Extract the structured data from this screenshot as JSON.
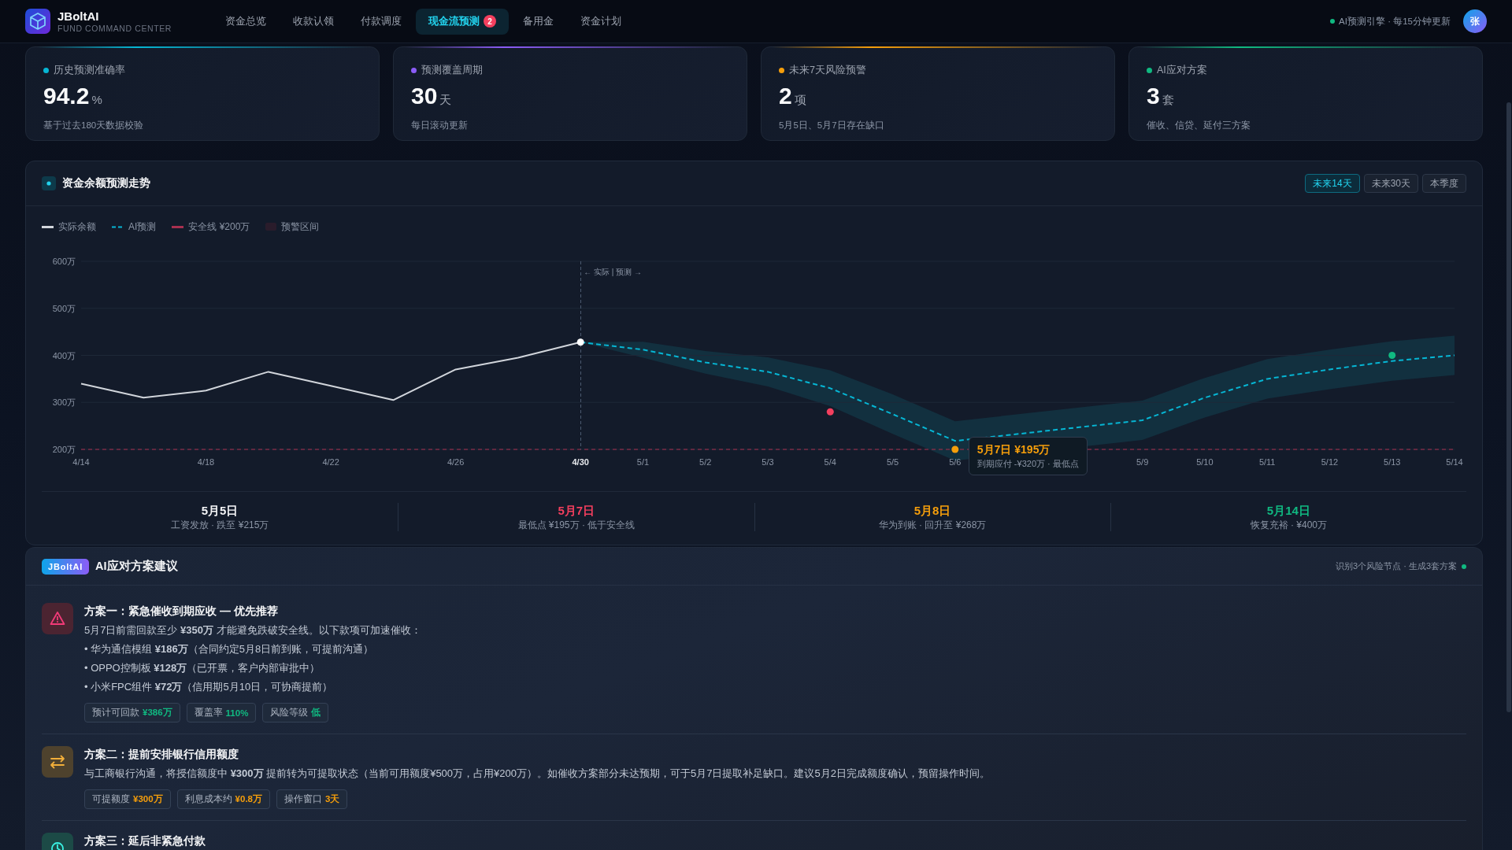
{
  "app": {
    "name": "JBoltAI",
    "subtitle": "FUND COMMAND CENTER"
  },
  "nav": [
    {
      "label": "资金总览",
      "selected": false
    },
    {
      "label": "收款认领",
      "selected": false
    },
    {
      "label": "付款调度",
      "selected": false
    },
    {
      "label": "现金流预测",
      "selected": true,
      "badge": "2"
    },
    {
      "label": "备用金",
      "selected": false
    },
    {
      "label": "资金计划",
      "selected": false
    }
  ],
  "engine": {
    "text": "AI预测引擎 · 每15分钟更新",
    "online": true
  },
  "user": {
    "avatar": "张"
  },
  "stats": [
    {
      "label": "历史预测准确率",
      "value": "94.2",
      "unit": "%",
      "note": "基于过去180天数据校验",
      "color": "#06b6d4"
    },
    {
      "label": "预测覆盖周期",
      "value": "30",
      "unit": "天",
      "note": "每日滚动更新",
      "color": "#8b5cf6"
    },
    {
      "label": "未来7天风险预警",
      "value": "2",
      "unit": "项",
      "note": "5月5日、5月7日存在缺口",
      "color": "#f59e0b"
    },
    {
      "label": "AI应对方案",
      "value": "3",
      "unit": "套",
      "note": "催收、信贷、延付三方案",
      "color": "#10b981"
    }
  ],
  "chart": {
    "ranges": [
      {
        "label": "未来14天",
        "selected": true
      },
      {
        "label": "未来30天",
        "selected": false
      },
      {
        "label": "本季度",
        "selected": false
      }
    ],
    "zone": {
      "label": "预警区间",
      "color": "#2a1c2b"
    },
    "chart_data": {
      "type": "line",
      "title": "资金余额预测走势",
      "categories": [
        "4/14",
        null,
        "4/18",
        null,
        "4/22",
        null,
        "4/26",
        null,
        "4/30",
        "5/1",
        "5/2",
        "5/3",
        "5/4",
        "5/5",
        "5/6",
        null,
        null,
        "5/9",
        "5/10",
        "5/11",
        "5/12",
        "5/13",
        "5/14"
      ],
      "ylim": [
        200,
        600
      ],
      "yticks": [
        {
          "value": 200,
          "label": "200万"
        },
        {
          "value": 300,
          "label": "300万"
        },
        {
          "value": 400,
          "label": "400万"
        },
        {
          "value": 500,
          "label": "500万"
        },
        {
          "value": 600,
          "label": "600万"
        }
      ],
      "grid": true,
      "series": [
        {
          "name": "实际余额",
          "color": "#d1d5db",
          "line_style": "solid",
          "values": [
            340,
            310,
            325,
            365,
            335,
            305,
            370,
            395,
            428,
            null,
            null,
            null,
            null,
            null,
            null,
            null,
            null,
            null,
            null,
            null,
            null,
            null,
            null
          ]
        },
        {
          "name": "AI预测",
          "color": "#06b6d4",
          "line_style": "dashed",
          "values": [
            null,
            null,
            null,
            null,
            null,
            null,
            null,
            null,
            428,
            412,
            385,
            365,
            330,
            275,
            218,
            null,
            null,
            262,
            310,
            350,
            370,
            388,
            400
          ]
        },
        {
          "color": "#f43f5e",
          "marker": "circle",
          "values": [
            null,
            null,
            null,
            null,
            null,
            null,
            null,
            null,
            null,
            null,
            null,
            null,
            280,
            null,
            null,
            null,
            null,
            null,
            null,
            null,
            null,
            null,
            null
          ]
        },
        {
          "color": "#f59e0b",
          "marker": "circle",
          "values": [
            null,
            null,
            null,
            null,
            null,
            null,
            null,
            null,
            null,
            null,
            null,
            null,
            null,
            null,
            200,
            null,
            null,
            null,
            null,
            null,
            null,
            null,
            null
          ]
        },
        {
          "color": "#10b981",
          "marker": "circle",
          "values": [
            null,
            null,
            null,
            null,
            null,
            null,
            null,
            null,
            null,
            null,
            null,
            null,
            null,
            null,
            null,
            null,
            null,
            null,
            null,
            null,
            null,
            400,
            null
          ]
        }
      ],
      "ref_lines": [
        {
          "axis": "y",
          "value": 200,
          "label": "安全线 ¥200万",
          "color": "#a8304f"
        },
        {
          "axis": "x",
          "value": "4/30",
          "label": "← 实际 | 预测 →",
          "color": "#4b5a70"
        }
      ],
      "annotations": [
        {
          "x": "5/6",
          "y": 200,
          "text": "5月7日 ¥195万"
        },
        {
          "x": "5/6",
          "y": 200,
          "text": "到期应付 -¥320万 · 最低点"
        }
      ]
    },
    "milestones": [
      {
        "date": "5月5日",
        "note": "工资发放 · 跌至 ¥215万",
        "color": "#f3f4f6"
      },
      {
        "date": "5月7日",
        "note": "最低点 ¥195万 · 低于安全线",
        "color": "#f43f5e"
      },
      {
        "date": "5月8日",
        "note": "华为到账 · 回升至 ¥268万",
        "color": "#f59e0b"
      },
      {
        "date": "5月14日",
        "note": "恢复充裕 · ¥400万",
        "color": "#10b981"
      }
    ]
  },
  "ai": {
    "badge": "JBoltAI",
    "title": "AI应对方案建议",
    "meta": "识别3个风险节点 · 生成3套方案",
    "active": true,
    "plans": [
      {
        "color": "#4b2431",
        "title": "方案一：紧急催收到期应收 — 优先推荐",
        "description": "5月7日前需回款至少 **¥350万** 才能避免跌破安全线。以下款项可加速催收：",
        "bullets": [
          "• 华为通信模组 **¥186万**（合同约定5月8日前到账，可提前沟通）",
          "• OPPO控制板 **¥128万**（已开票，客户内部审批中）",
          "• 小米FPC组件 **¥72万**（信用期5月10日，可协商提前）"
        ],
        "tags": [
          {
            "label": "预计可回款",
            "value": "¥386万",
            "color": "#10b981"
          },
          {
            "label": "覆盖率",
            "value": "110%",
            "color": "#10b981"
          },
          {
            "label": "风险等级",
            "value": "低",
            "color": "#10b981"
          }
        ]
      },
      {
        "color": "#4e422d",
        "title": "方案二：提前安排银行信用额度",
        "description": "与工商银行沟通，将授信额度中 **¥300万** 提前转为可提取状态（当前可用额度¥500万，占用¥200万）。如催收方案部分未达预期，可于5月7日提取补足缺口。建议5月2日完成额度确认，预留操作时间。",
        "tags": [
          {
            "label": "可提额度",
            "value": "¥300万",
            "color": "#f59e0b"
          },
          {
            "label": "利息成本约",
            "value": "¥0.8万",
            "color": "#f59e0b"
          },
          {
            "label": "操作窗口",
            "value": "3天",
            "color": "#f59e0b"
          }
        ]
      },
      {
        "color": "#1c4a46",
        "title": "方案三：延后非紧急付款"
      }
    ]
  }
}
